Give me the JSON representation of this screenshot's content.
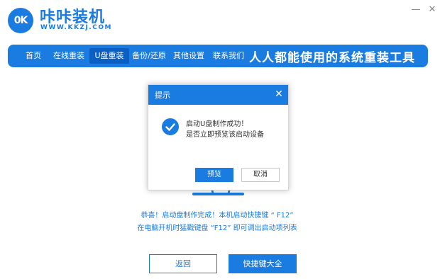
{
  "app": {
    "logo_text": "0K",
    "name": "咔咔装机",
    "url": "WWW.KKZJ.COM"
  },
  "window": {
    "minimize_symbol": "—",
    "close_symbol": "✕"
  },
  "nav": {
    "items": [
      {
        "label": "首页"
      },
      {
        "label": "在线重装"
      },
      {
        "label": "U盘重装",
        "active": true
      },
      {
        "label": "备份/还原"
      },
      {
        "label": "其他设置"
      },
      {
        "label": "联系我们"
      }
    ],
    "slogan": "人人都能使用的系统重装工具"
  },
  "dialog": {
    "title": "提示",
    "close_symbol": "✕",
    "message_line1": "启动U盘制作成功！",
    "message_line2": "是否立即预览该启动设备",
    "preview_label": "预览",
    "cancel_label": "取消",
    "icon": "check-circle-icon"
  },
  "info": {
    "line1": "恭喜！启动盘制作完成！本机启动快捷键 “ F12”",
    "line2": "在电脑开机时猛戳键盘 “F12” 即可调出启动项列表"
  },
  "buttons": {
    "back_label": "返回",
    "hotkeys_label": "快捷键大全"
  },
  "colors": {
    "accent": "#1a7be0",
    "accent_dark": "#0b5fc2"
  }
}
